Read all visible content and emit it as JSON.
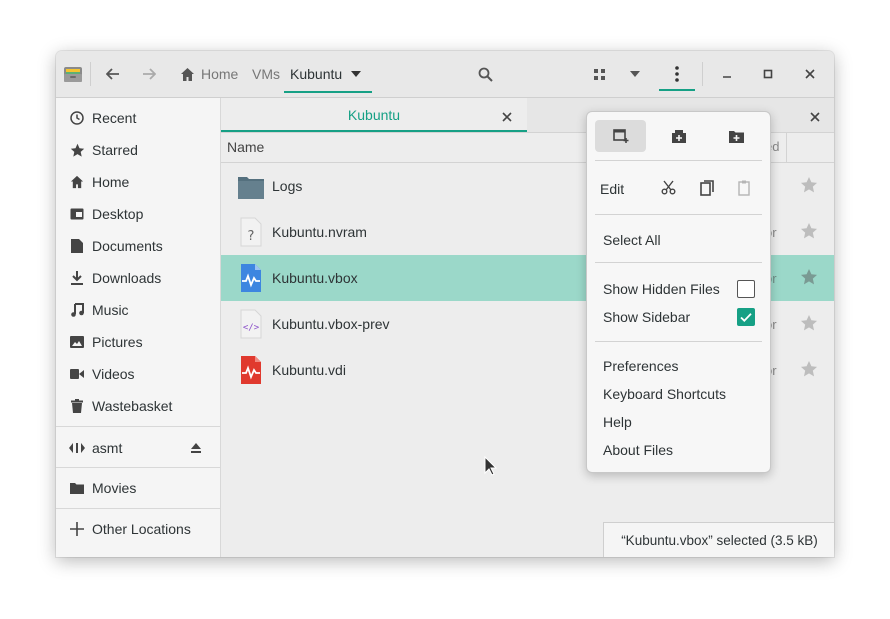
{
  "header": {
    "breadcrumbs": [
      "Home",
      "VMs",
      "Kubuntu"
    ],
    "icons": [
      "files-app-icon",
      "back-arrow-icon",
      "forward-arrow-icon",
      "home-icon",
      "breadcrumb-dropdown-icon",
      "search-icon",
      "grid-view-icon",
      "view-options-icon",
      "menu-icon",
      "minimize-icon",
      "maximize-icon",
      "close-icon"
    ]
  },
  "sidebar": {
    "items": [
      {
        "label": "Recent",
        "icon": "clock-icon"
      },
      {
        "label": "Starred",
        "icon": "star-icon"
      },
      {
        "label": "Home",
        "icon": "home-icon"
      },
      {
        "label": "Desktop",
        "icon": "desktop-icon"
      },
      {
        "label": "Documents",
        "icon": "document-icon"
      },
      {
        "label": "Downloads",
        "icon": "download-icon"
      },
      {
        "label": "Music",
        "icon": "music-icon"
      },
      {
        "label": "Pictures",
        "icon": "picture-icon"
      },
      {
        "label": "Videos",
        "icon": "video-icon"
      },
      {
        "label": "Wastebasket",
        "icon": "trash-icon"
      }
    ],
    "network": {
      "label": "asmt",
      "icon": "network-icon"
    },
    "bookmark": {
      "label": "Movies",
      "icon": "folder-icon"
    },
    "other": {
      "label": "Other Locations",
      "icon": "plus-icon"
    }
  },
  "tabs": [
    {
      "label": "Kubuntu"
    }
  ],
  "columns": {
    "name": "Name",
    "partial": "ed"
  },
  "files": [
    {
      "name": "Logs",
      "icon": "folder-icon",
      "partial": ""
    },
    {
      "name": "Kubuntu.nvram",
      "icon": "unknown-file-icon",
      "partial": "or"
    },
    {
      "name": "Kubuntu.vbox",
      "icon": "vbox-file-icon",
      "partial": "or",
      "selected": true
    },
    {
      "name": "Kubuntu.vbox-prev",
      "icon": "xml-file-icon",
      "partial": "or"
    },
    {
      "name": "Kubuntu.vdi",
      "icon": "vdi-file-icon",
      "partial": "or"
    }
  ],
  "menu": {
    "top_icons": [
      "new-window-icon",
      "new-tab-icon",
      "new-folder-icon"
    ],
    "edit_label": "Edit",
    "edit_icons": [
      "cut-icon",
      "copy-icon",
      "paste-icon"
    ],
    "select_all": "Select All",
    "show_hidden": {
      "label": "Show Hidden Files",
      "checked": false
    },
    "show_sidebar": {
      "label": "Show Sidebar",
      "checked": true
    },
    "preferences": "Preferences",
    "shortcuts": "Keyboard Shortcuts",
    "help": "Help",
    "about": "About Files"
  },
  "status": "“Kubuntu.vbox” selected  (3.5 kB)",
  "colors": {
    "accent": "#16a085",
    "selection": "#9bd8c9"
  }
}
